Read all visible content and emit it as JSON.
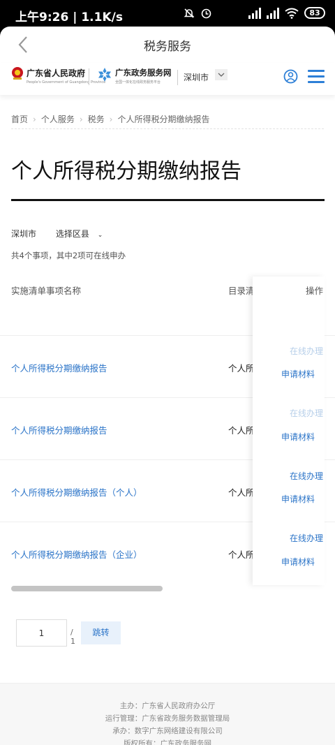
{
  "status_bar": {
    "time": "上午9:26 | 1.1K/s",
    "battery": "83",
    "icons": [
      "mute-icon",
      "alarm-icon",
      "signal-icon",
      "signal-icon",
      "wifi-icon",
      "battery-icon"
    ]
  },
  "nav": {
    "title": "税务服务",
    "back_icon": "chevron-left-icon"
  },
  "brand": {
    "gov_name": "广东省人民政府",
    "gov_name_en": "People's Government of Guangdong Province",
    "portal_name": "广东政务服务网",
    "portal_sub": "全国一体化在线政务服务平台",
    "city": "深圳市",
    "accent": "#2b74c8"
  },
  "breadcrumb": [
    "首页",
    "个人服务",
    "税务",
    "个人所得税分期缴纳报告"
  ],
  "page_title": "个人所得税分期缴纳报告",
  "filter": {
    "city": "深圳市",
    "district": "选择区县"
  },
  "count_text": "共4个事项，其中2项可在线申办",
  "table": {
    "headers": {
      "name": "实施清单事项名称",
      "directory": "目录清",
      "action": "操作"
    },
    "rows": [
      {
        "name": "个人所得税分期缴纳报告",
        "directory": "个人所得",
        "online": "在线办理",
        "online_enabled": false,
        "materials": "申请材料"
      },
      {
        "name": "个人所得税分期缴纳报告",
        "directory": "个人所得",
        "online": "在线办理",
        "online_enabled": false,
        "materials": "申请材料"
      },
      {
        "name": "个人所得税分期缴纳报告（个人）",
        "directory": "个人所得",
        "online": "在线办理",
        "online_enabled": true,
        "materials": "申请材料"
      },
      {
        "name": "个人所得税分期缴纳报告（企业）",
        "directory": "个人所得",
        "online": "在线办理",
        "online_enabled": true,
        "materials": "申请材料"
      }
    ]
  },
  "pagination": {
    "current": "1",
    "total": "/ 1",
    "jump": "跳转"
  },
  "footer": [
    "主办：广东省人民政府办公厅",
    "运行管理：广东省政务服务数据管理局",
    "承办：数字广东网络建设有限公司",
    "版权所有：广东政务服务网"
  ]
}
